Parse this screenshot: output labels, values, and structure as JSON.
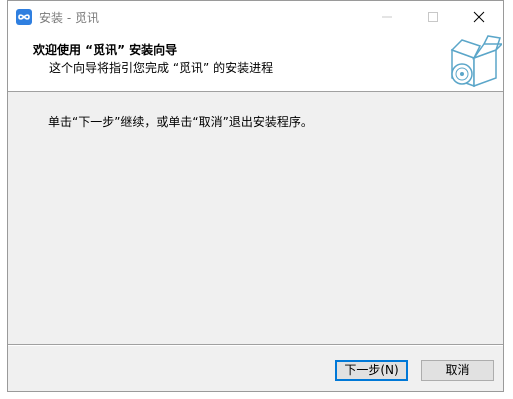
{
  "window": {
    "title": "安装 - 觅讯",
    "app_icon": "app-logo-icon",
    "controls": {
      "minimize": "minimize-icon",
      "maximize": "maximize-icon",
      "close": "close-icon"
    }
  },
  "header": {
    "title": "欢迎使用 “觅讯” 安装向导",
    "subtitle": "这个向导将指引您完成 “觅讯” 的安装进程",
    "image": "software-box-icon"
  },
  "body": {
    "instruction": "单击“下一步”继续，或单击“取消”退出安装程序。"
  },
  "buttons": {
    "next_label": "下一步(N)",
    "cancel_label": "取消"
  },
  "colors": {
    "accent": "#0078d7",
    "app_icon": "#2f7fe0",
    "window_bg": "#f0f0f0",
    "header_bg": "#ffffff",
    "box_icon": "#5ba6c9"
  }
}
